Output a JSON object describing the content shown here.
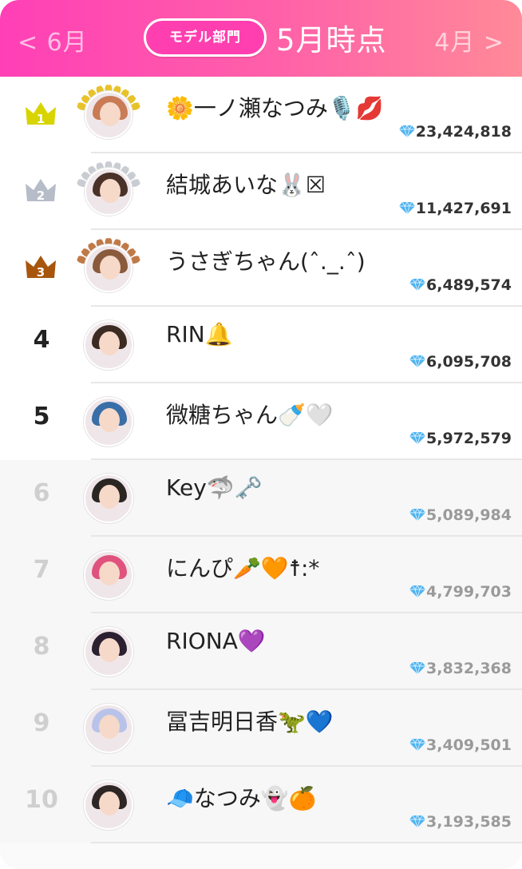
{
  "header": {
    "prev_label": "< 6月",
    "next_label": "4月 >",
    "category_badge": "モデル部門",
    "period_title": "5月時点"
  },
  "colors": {
    "header_gradient_start": "#ff3fb6",
    "header_gradient_end": "#ff8a98",
    "gold": "#d7d400",
    "silver": "#b6bcc8",
    "bronze": "#a8560e",
    "diamond": "#4fb3f0"
  },
  "ranking": [
    {
      "rank": "1",
      "name": "🌼一ノ瀬なつみ🎙️💋",
      "score": "23,424,818",
      "crown": "gold",
      "avatar_hair": "#c97b56"
    },
    {
      "rank": "2",
      "name": "結城あいな🐰☒",
      "score": "11,427,691",
      "crown": "silver",
      "avatar_hair": "#4a3228"
    },
    {
      "rank": "3",
      "name": "うさぎちゃん(ˆ._.ˆ)",
      "score": "6,489,574",
      "crown": "bronze",
      "avatar_hair": "#8a5a3c"
    },
    {
      "rank": "4",
      "name": "RIN🔔",
      "score": "6,095,708",
      "crown": "",
      "avatar_hair": "#3b2b22"
    },
    {
      "rank": "5",
      "name": "微糖ちゃん🍼🤍",
      "score": "5,972,579",
      "crown": "",
      "avatar_hair": "#3a6ea8"
    },
    {
      "rank": "6",
      "name": "Key🦈🗝️",
      "score": "5,089,984",
      "crown": "",
      "avatar_hair": "#2b2622"
    },
    {
      "rank": "7",
      "name": "にんぴ🥕🧡☨:*",
      "score": "4,799,703",
      "crown": "",
      "avatar_hair": "#e0527e"
    },
    {
      "rank": "8",
      "name": "RIONA💜",
      "score": "3,832,368",
      "crown": "",
      "avatar_hair": "#2a2030"
    },
    {
      "rank": "9",
      "name": "冨吉明日香🦖💙",
      "score": "3,409,501",
      "crown": "",
      "avatar_hair": "#b9c3ea"
    },
    {
      "rank": "10",
      "name": "🧢なつみ👻🍊",
      "score": "3,193,585",
      "crown": "",
      "avatar_hair": "#2e2624"
    }
  ]
}
